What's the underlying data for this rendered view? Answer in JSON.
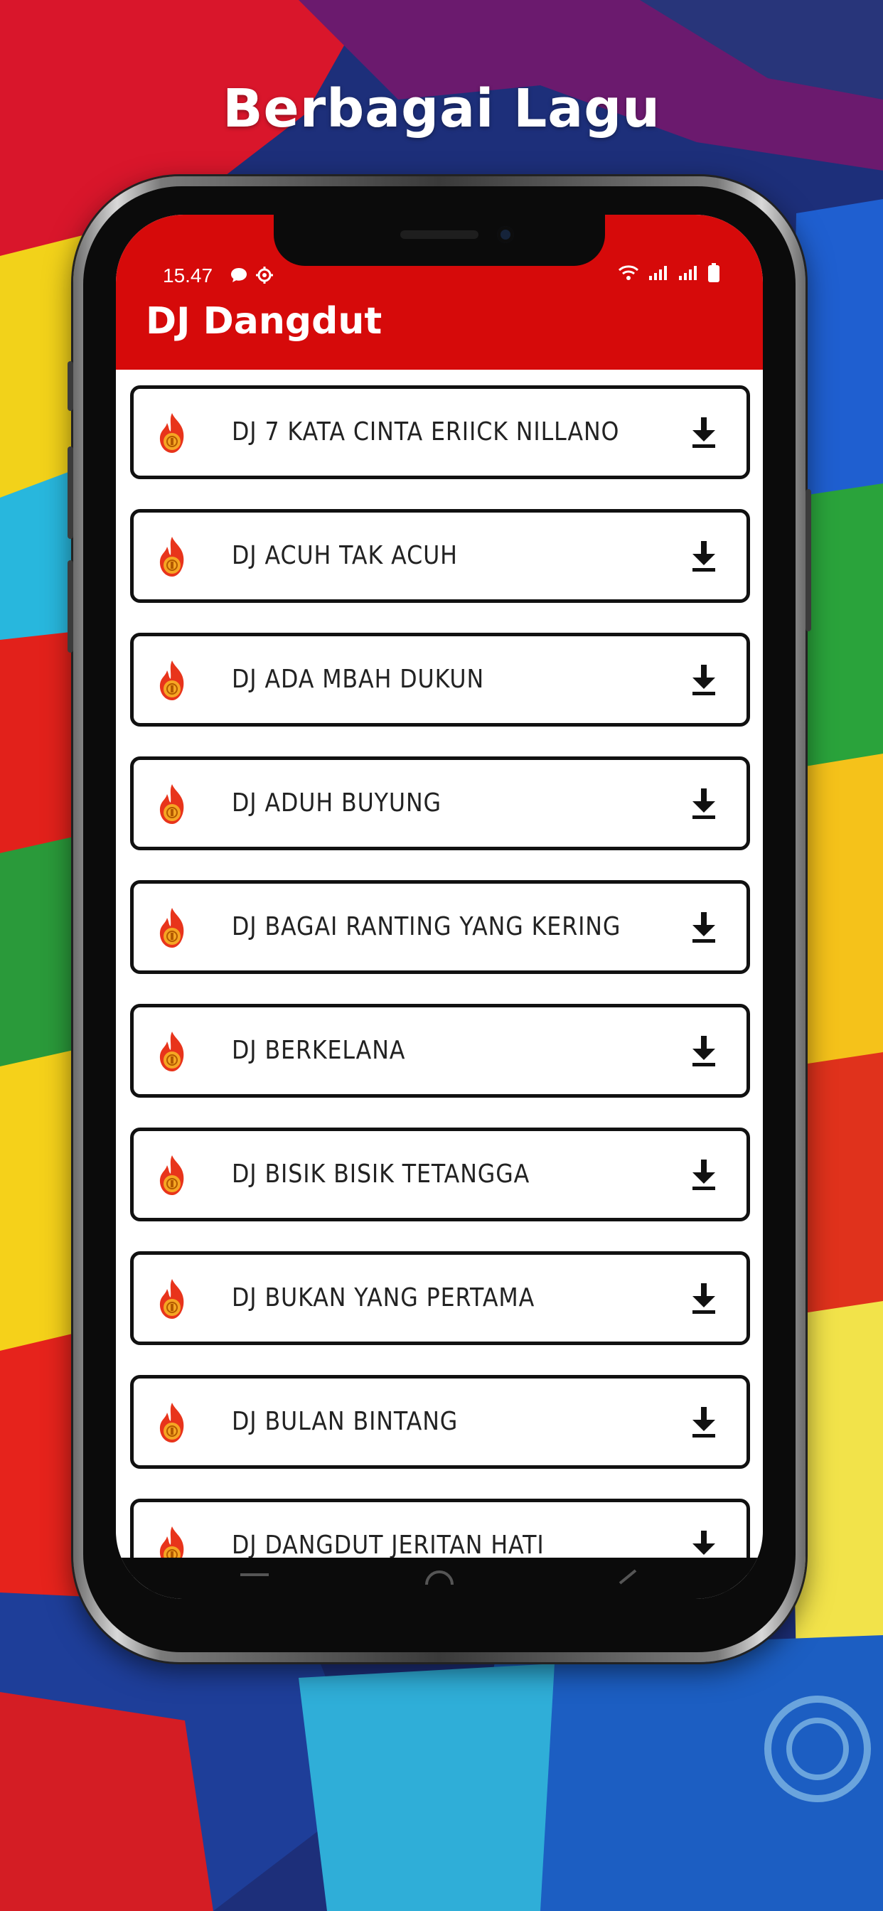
{
  "promo": {
    "headline": "Berbagai Lagu"
  },
  "status_bar": {
    "time": "15.47"
  },
  "app_bar": {
    "title": "DJ Dangdut"
  },
  "songs": [
    {
      "title": "DJ 7 KATA CINTA ERIICK NILLANO"
    },
    {
      "title": "DJ ACUH TAK ACUH"
    },
    {
      "title": "DJ ADA MBAH DUKUN"
    },
    {
      "title": "DJ ADUH BUYUNG"
    },
    {
      "title": "DJ BAGAI RANTING YANG KERING"
    },
    {
      "title": "DJ BERKELANA"
    },
    {
      "title": "DJ BISIK BISIK TETANGGA"
    },
    {
      "title": "DJ BUKAN YANG PERTAMA"
    },
    {
      "title": "DJ BULAN BINTANG"
    },
    {
      "title": "DJ DANGDUT JERITAN HATI"
    }
  ],
  "icons": {
    "song": "flame-coin-icon",
    "action": "download-icon"
  },
  "colors": {
    "app_bar": "#d60a0a",
    "flame_outer": "#e8341b",
    "flame_inner": "#f5a623"
  }
}
